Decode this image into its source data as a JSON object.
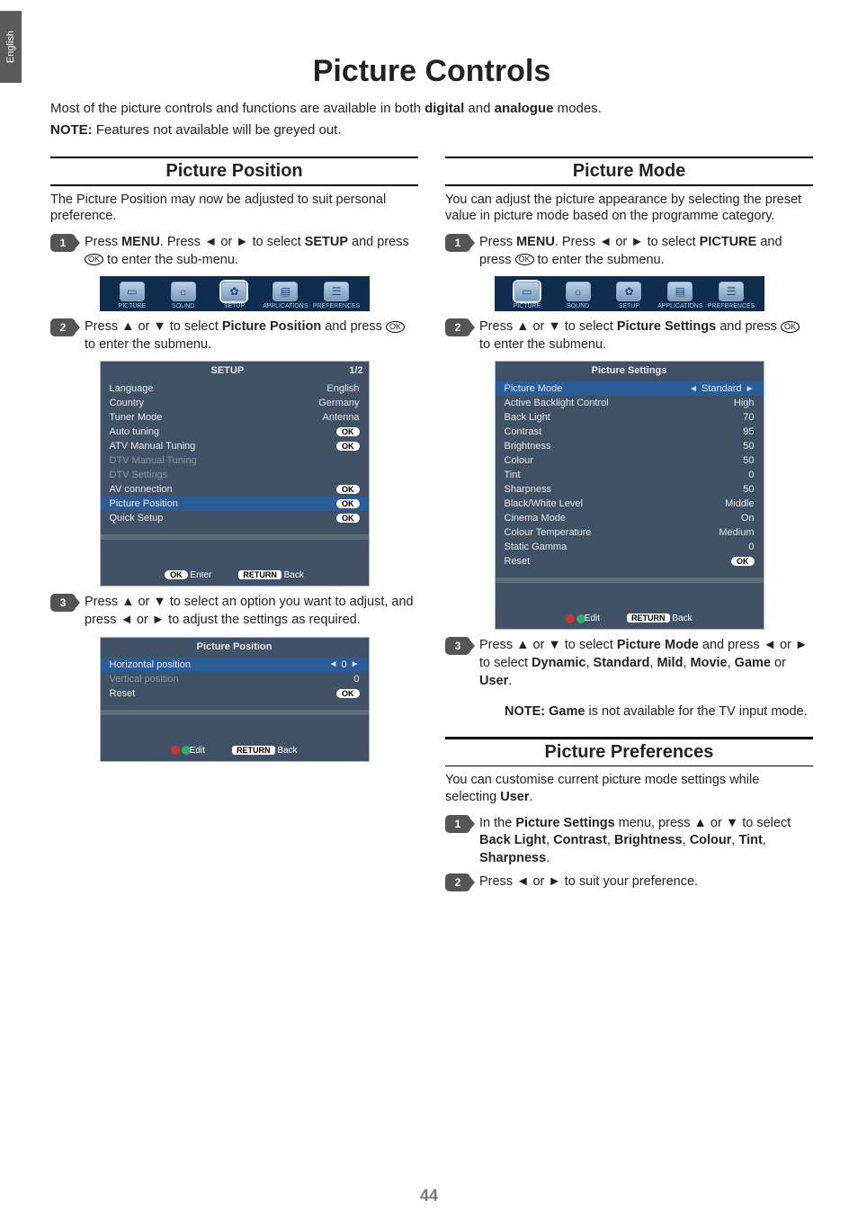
{
  "lang_tab": "English",
  "title": "Picture Controls",
  "intro1_a": "Most of the picture controls and functions are available in both ",
  "intro1_b": "digital",
  "intro1_c": " and ",
  "intro1_d": "analogue",
  "intro1_e": " modes.",
  "intro2_a": "NOTE:",
  "intro2_b": " Features not available will be greyed out.",
  "ok_pill": "OK",
  "page_num": "44",
  "tabs": {
    "picture": "PICTURE",
    "sound": "SOUND",
    "setup": "SETUP",
    "applications": "APPLICATIONS",
    "preferences": "PREFERENCES"
  },
  "left": {
    "head": "Picture Position",
    "desc": "The Picture Position may now be adjusted to suit personal preference.",
    "step1_a": "Press ",
    "step1_b": "MENU",
    "step1_c": ". Press ◄ or ► to select ",
    "step1_d": "SETUP",
    "step1_e": " and press ",
    "step1_f": " to enter the sub-menu.",
    "step2_a": "Press ▲ or ▼ to select ",
    "step2_b": "Picture Position",
    "step2_c": " and press ",
    "step2_d": " to enter the submenu.",
    "step3": "Press ▲ or ▼ to select an option you want to adjust, and press ◄ or ► to adjust the settings as required.",
    "setup_box": {
      "title": "SETUP",
      "page": "1/2",
      "rows": [
        {
          "label": "Language",
          "val": "English"
        },
        {
          "label": "Country",
          "val": "Germany"
        },
        {
          "label": "Tuner Mode",
          "val": "Antenna"
        },
        {
          "label": "Auto tuning",
          "val": "OK"
        },
        {
          "label": "ATV Manual Tuning",
          "val": "OK"
        },
        {
          "label": "DTV Manual Tuning",
          "val": "",
          "dis": true
        },
        {
          "label": "DTV Settings",
          "val": "",
          "dis": true
        },
        {
          "label": "AV connection",
          "val": "OK"
        },
        {
          "label": "Picture Position",
          "val": "OK",
          "hl": true
        },
        {
          "label": "Quick Setup",
          "val": "OK"
        }
      ],
      "foot_ok": "OK",
      "foot_enter": "Enter",
      "foot_return": "RETURN",
      "foot_back": "Back"
    },
    "pp_box": {
      "title": "Picture Position",
      "rows": [
        {
          "label": "Horizontal position",
          "val": "0",
          "hl": true,
          "arrows": true
        },
        {
          "label": "Vertical position",
          "val": "0",
          "dis": true
        },
        {
          "label": "Reset",
          "val": "OK"
        }
      ],
      "foot_edit": "Edit",
      "foot_return": "RETURN",
      "foot_back": "Back"
    }
  },
  "right": {
    "head": "Picture Mode",
    "desc": "You can adjust the picture appearance by selecting the preset value in picture mode based on the programme category.",
    "step1_a": "Press ",
    "step1_b": "MENU",
    "step1_c": ". Press ◄ or ► to select ",
    "step1_d": "PICTURE",
    "step1_e": " and press ",
    "step1_f": " to enter the submenu.",
    "step2_a": "Press ▲ or ▼ to select ",
    "step2_b": "Picture Settings",
    "step2_c": " and press ",
    "step2_d": " to enter the submenu.",
    "step3_a": "Press ▲ or ▼ to select ",
    "step3_b": "Picture Mode",
    "step3_c": " and press ◄ or ► to select ",
    "step3_d": "Dynamic",
    "step3_e": ", ",
    "step3_f": "Standard",
    "step3_g": ", ",
    "step3_h": "Mild",
    "step3_i": ", ",
    "step3_j": "Movie",
    "step3_k": ", ",
    "step3_l": "Game",
    "step3_m": " or ",
    "step3_n": "User",
    "step3_o": ".",
    "note_a": "NOTE: Game",
    "note_b": " is not available for the TV input mode.",
    "ps_box": {
      "title": "Picture Settings",
      "rows": [
        {
          "label": "Picture Mode",
          "val": "Standard",
          "hl": true,
          "arrows": true
        },
        {
          "label": "Active Backlight Control",
          "val": "High"
        },
        {
          "label": "Back Light",
          "val": "70"
        },
        {
          "label": "Contrast",
          "val": "95"
        },
        {
          "label": "Brightness",
          "val": "50"
        },
        {
          "label": "Colour",
          "val": "50"
        },
        {
          "label": "Tint",
          "val": "0"
        },
        {
          "label": "Sharpness",
          "val": "50"
        },
        {
          "label": "Black/White Level",
          "val": "Middle"
        },
        {
          "label": "Cinema Mode",
          "val": "On"
        },
        {
          "label": "Colour Temperature",
          "val": "Medium"
        },
        {
          "label": "Static Gamma",
          "val": "0"
        },
        {
          "label": "Reset",
          "val": "OK"
        }
      ],
      "foot_edit": "Edit",
      "foot_return": "RETURN",
      "foot_back": "Back"
    },
    "pref": {
      "head": "Picture Preferences",
      "desc_a": "You can customise current picture mode settings while selecting ",
      "desc_b": "User",
      "desc_c": ".",
      "step1_a": "In the ",
      "step1_b": "Picture Settings",
      "step1_c": " menu, press ▲ or ▼ to select ",
      "step1_d": "Back Light",
      "step1_e": ", ",
      "step1_f": "Contrast",
      "step1_g": ", ",
      "step1_h": "Brightness",
      "step1_i": ", ",
      "step1_j": "Colour",
      "step1_k": ", ",
      "step1_l": "Tint",
      "step1_m": ", ",
      "step1_n": "Sharpness",
      "step1_o": ".",
      "step2": "Press ◄ or ► to suit your preference."
    }
  },
  "badges": {
    "1": "1",
    "2": "2",
    "3": "3"
  }
}
